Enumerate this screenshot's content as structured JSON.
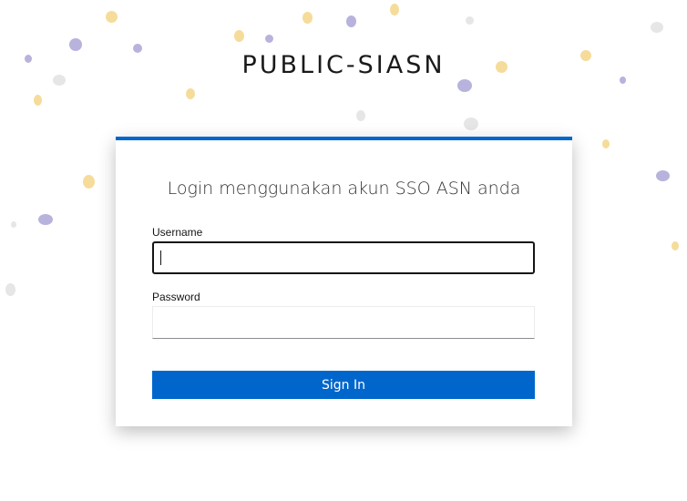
{
  "brand": {
    "title": "PUBLIC-SIASN"
  },
  "login": {
    "heading": "Login menggunakan akun SSO ASN anda",
    "username_label": "Username",
    "username_value": "",
    "password_label": "Password",
    "password_value": "",
    "submit_label": "Sign In"
  },
  "colors": {
    "accent": "#0066cc",
    "confetti_yellow": "#f6dc9a",
    "confetti_purple": "#b7b3dc",
    "confetti_gray": "#e6e6e6"
  }
}
